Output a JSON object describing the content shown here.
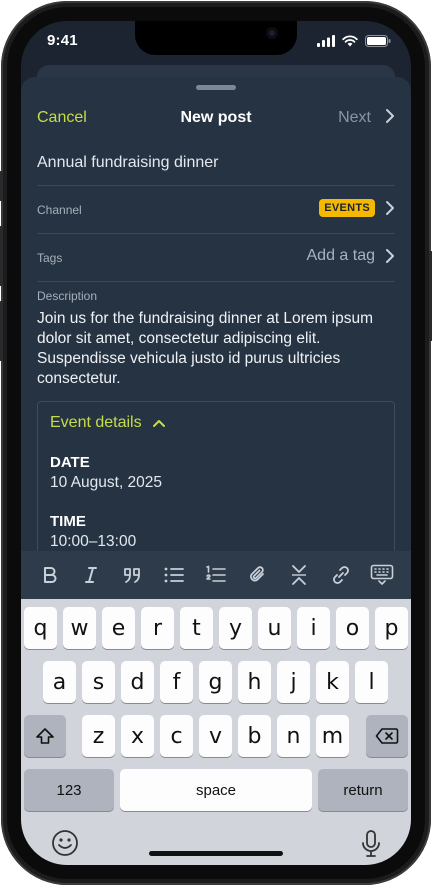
{
  "status": {
    "time": "9:41"
  },
  "nav": {
    "cancel": "Cancel",
    "title": "New post",
    "next": "Next"
  },
  "post": {
    "title_value": "Annual fundraising dinner",
    "channel_label": "Channel",
    "channel_value": "EVENTS",
    "tags_label": "Tags",
    "tags_placeholder": "Add a tag",
    "description_label": "Description",
    "description": "Join us for the fundraising dinner at Lorem ipsum dolor sit amet, consectetur adipiscing elit. Suspendisse vehicula justo id purus ultricies consectetur."
  },
  "event": {
    "header": "Event details",
    "date_label": "DATE",
    "date_value": "10 August, 2025",
    "time_label": "TIME",
    "time_value": "10:00–13:00"
  },
  "toolbar": {
    "icons": [
      "bold-icon",
      "italic-icon",
      "quote-icon",
      "bullet-list-icon",
      "numbered-list-icon",
      "attachment-icon",
      "collapse-icon",
      "link-icon",
      "keyboard-hide-icon"
    ]
  },
  "keyboard": {
    "row1": [
      "q",
      "w",
      "e",
      "r",
      "t",
      "y",
      "u",
      "i",
      "o",
      "p"
    ],
    "row2": [
      "a",
      "s",
      "d",
      "f",
      "g",
      "h",
      "j",
      "k",
      "l"
    ],
    "row3": [
      "z",
      "x",
      "c",
      "v",
      "b",
      "n",
      "m"
    ],
    "numbers": "123",
    "space": "space",
    "return": "return"
  },
  "colors": {
    "accent": "#c6dd4a",
    "badge": "#f5b800",
    "sheet": "#263342"
  }
}
